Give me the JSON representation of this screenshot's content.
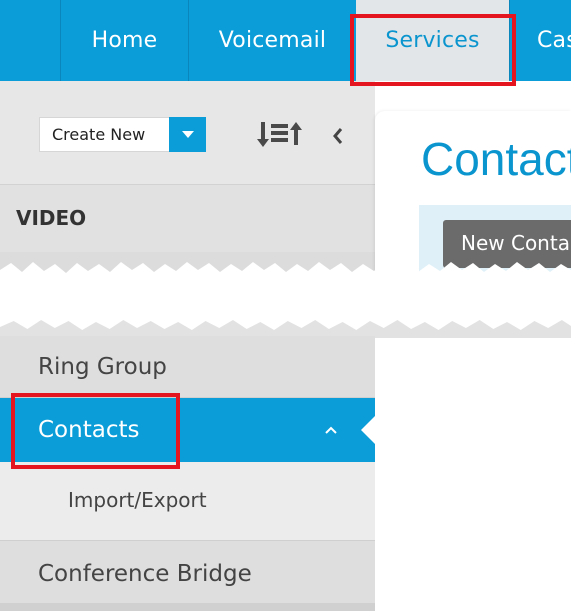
{
  "topnav": {
    "tabs": [
      {
        "label": "Home",
        "active": false
      },
      {
        "label": "Voicemail",
        "active": false
      },
      {
        "label": "Services",
        "active": true
      },
      {
        "label": "Cas",
        "active": false
      }
    ]
  },
  "sidebar": {
    "create_new": {
      "label": "Create New"
    },
    "section_label": "VIDEO",
    "menu": [
      {
        "label": "Ring Group"
      },
      {
        "label": "Contacts",
        "active": true,
        "expanded": true,
        "children": [
          {
            "label": "Import/Export"
          }
        ]
      },
      {
        "label": "Conference Bridge"
      }
    ]
  },
  "main": {
    "title": "Contact",
    "new_button": "New Contac"
  },
  "icons": {
    "sort": "sort-icon",
    "collapse": "chevron-left-icon",
    "dropdown": "triangle-down-icon",
    "expanded": "chevron-up-icon"
  },
  "colors": {
    "brand_blue": "#0a9dd8",
    "highlight_red": "#e4151f",
    "button_gray": "#6b6b6b"
  }
}
